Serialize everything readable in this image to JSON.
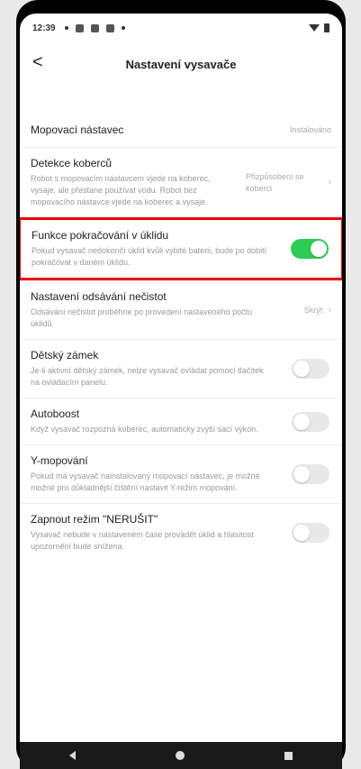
{
  "status": {
    "time": "12:39"
  },
  "header": {
    "title": "Nastavení vysavače",
    "back_glyph": "<"
  },
  "rows": {
    "mop": {
      "title": "Mopovací nástavec",
      "value": "Instalováno"
    },
    "carpet": {
      "title": "Detekce koberců",
      "desc": "Robot s mopovacím nástavcem vjede na koberec, vysaje, ale přestane používat vodu. Robot bez mopovacího nástavce vjede na koberec a vysaje.",
      "value": "Přizpůsobení se koberci"
    },
    "resume": {
      "title": "Funkce pokračování v úklidu",
      "desc": "Pokud vysavač nedokončí úklid kvůli vybité baterii, bude po dobití pokračovat v daném úklidu.",
      "toggle": true
    },
    "dirt": {
      "title": "Nastavení odsávání nečistot",
      "desc": "Odsávání nečistot proběhne po provedení nastaveného počtu úklidů.",
      "value": "Skrýt"
    },
    "childlock": {
      "title": "Dětský zámek",
      "desc": "Je-li aktivní dětský zámek, nelze vysavač ovládat pomocí tlačítek na ovládacím panelu.",
      "toggle": false
    },
    "autoboost": {
      "title": "Autoboost",
      "desc": "Když vysavač rozpozná koberec, automaticky zvýší sací výkon.",
      "toggle": false
    },
    "ymop": {
      "title": "Y-mopování",
      "desc": "Pokud má vysavač nainstalovaný mopovací nástavec, je možné možné pro důkladnější čištění nastavit Y-režim mopování.",
      "toggle": false
    },
    "dnd": {
      "title": "Zapnout režim \"NERUŠIT\"",
      "desc": "Vysavač nebude v nastaveném čase provádět úklid a hlasitost upozornění bude snížena.",
      "toggle": false
    }
  },
  "icons": {
    "back": "chevron-left-icon",
    "chevron": "chevron-right-icon"
  },
  "colors": {
    "toggle_on": "#2ecb55",
    "highlight": "#e00000"
  }
}
